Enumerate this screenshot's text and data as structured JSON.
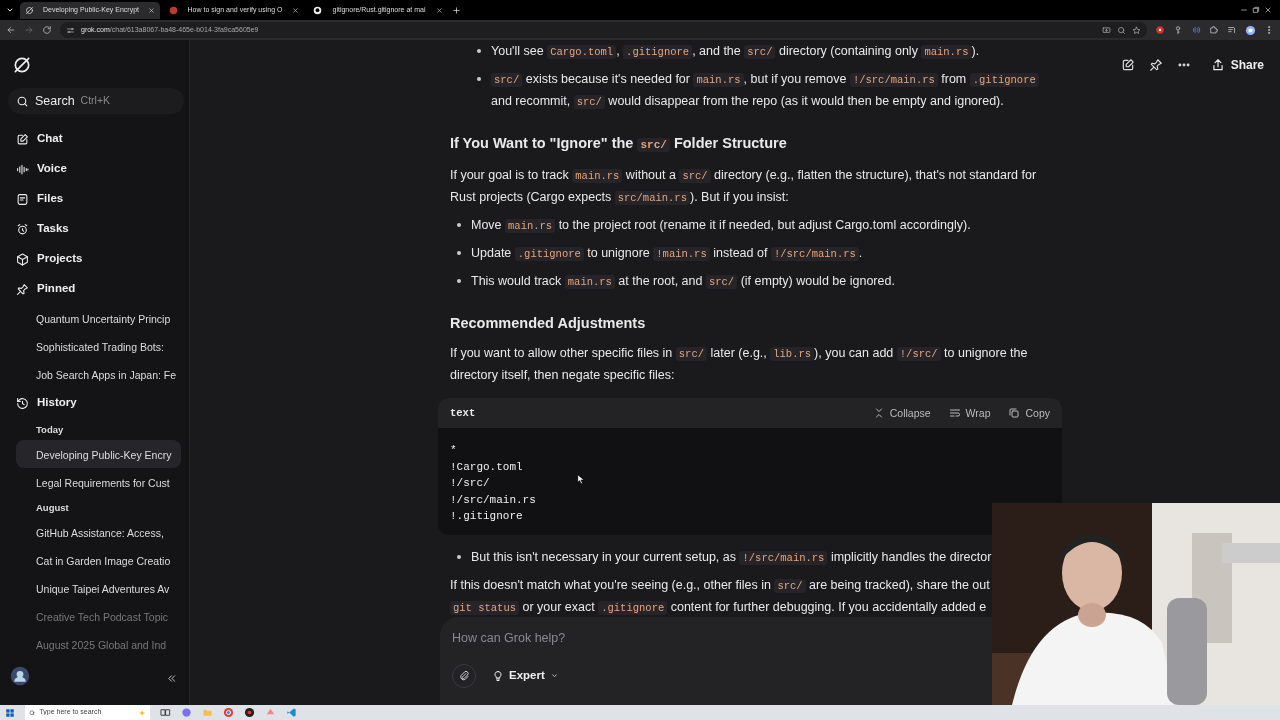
{
  "browser": {
    "tabs": [
      {
        "title": "Developing Public-Key Encrypt",
        "selected": true
      },
      {
        "title": "How to sign and verify using O",
        "selected": false
      },
      {
        "title": "gitignore/Rust.gitignore at mai",
        "selected": false
      }
    ],
    "address": {
      "host": "grok.com",
      "path": "/chat/613a8067-ba48-465e-b014-3fa9ca5605e9"
    }
  },
  "sidebar": {
    "search": {
      "label": "Search",
      "shortcut": "Ctrl+K"
    },
    "items": [
      {
        "label": "Chat"
      },
      {
        "label": "Voice"
      },
      {
        "label": "Files"
      },
      {
        "label": "Tasks"
      },
      {
        "label": "Projects"
      },
      {
        "label": "Pinned",
        "children": [
          {
            "label": "Quantum Uncertainty Princip",
            "selected": false,
            "dim": false
          },
          {
            "label": "Sophisticated Trading Bots:",
            "selected": false,
            "dim": false
          },
          {
            "label": "Job Search Apps in Japan: Fe",
            "selected": false,
            "dim": false
          }
        ]
      },
      {
        "label": "History",
        "groups": [
          {
            "label": "Today",
            "children": [
              {
                "label": "Developing Public-Key Encry",
                "selected": true,
                "dim": false
              },
              {
                "label": "Legal Requirements for Cust",
                "selected": false,
                "dim": false
              }
            ]
          },
          {
            "label": "August",
            "children": [
              {
                "label": "GitHub Assistance: Access,",
                "selected": false,
                "dim": false
              },
              {
                "label": "Cat in Garden Image Creatio",
                "selected": false,
                "dim": false
              },
              {
                "label": "Unique Taipei Adventures Av",
                "selected": false,
                "dim": false
              },
              {
                "label": "Creative Tech Podcast Topic",
                "selected": false,
                "dim": true
              },
              {
                "label": "August 2025 Global and Ind",
                "selected": false,
                "dim": true
              }
            ]
          }
        ]
      }
    ]
  },
  "header": {
    "share": "Share"
  },
  "message": [
    {
      "kind": "subbullet",
      "parts": [
        "You'll see ",
        {
          "code": "Cargo.toml"
        },
        ", ",
        {
          "code": ".gitignore"
        },
        ", and the ",
        {
          "code": "src/"
        },
        " directory (containing only ",
        {
          "code": "main.rs"
        },
        ")."
      ]
    },
    {
      "kind": "subbullet",
      "parts": [
        {
          "code": "src/"
        },
        " exists because it's needed for ",
        {
          "code": "main.rs"
        },
        ", but if you remove ",
        {
          "code": "!/src/main.rs"
        },
        " from ",
        {
          "code": ".gitignore"
        },
        " and recommit, ",
        {
          "code": "src/"
        },
        " would disappear from the repo (as it would then be empty and ignored)."
      ]
    },
    {
      "kind": "heading",
      "parts": [
        "If You Want to \"Ignore\" the ",
        {
          "code": "src/"
        },
        " Folder Structure"
      ]
    },
    {
      "kind": "paragraph",
      "parts": [
        "If your goal is to track ",
        {
          "code": "main.rs"
        },
        " without a ",
        {
          "code": "src/"
        },
        " directory (e.g., flatten the structure), that's not standard for Rust projects (Cargo expects ",
        {
          "code": "src/main.rs"
        },
        "). But if you insist:"
      ]
    },
    {
      "kind": "bullet",
      "parts": [
        "Move ",
        {
          "code": "main.rs"
        },
        " to the project root (rename it if needed, but adjust Cargo.toml accordingly)."
      ]
    },
    {
      "kind": "bullet",
      "parts": [
        "Update ",
        {
          "code": ".gitignore"
        },
        " to unignore ",
        {
          "code": "!main.rs"
        },
        " instead of ",
        {
          "code": "!/src/main.rs"
        },
        "."
      ]
    },
    {
      "kind": "bullet",
      "parts": [
        "This would track ",
        {
          "code": "main.rs"
        },
        " at the root, and ",
        {
          "code": "src/"
        },
        " (if empty) would be ignored."
      ]
    },
    {
      "kind": "heading",
      "parts": [
        "Recommended Adjustments"
      ]
    },
    {
      "kind": "paragraph",
      "parts": [
        "If you want to allow other specific files in ",
        {
          "code": "src/"
        },
        " later (e.g., ",
        {
          "code": "lib.rs"
        },
        "), you can add ",
        {
          "code": "!/src/"
        },
        " to unignore the directory itself, then negate specific files:"
      ]
    },
    {
      "kind": "codeblock",
      "language": "text",
      "actions": [
        {
          "label": "Collapse"
        },
        {
          "label": "Wrap"
        },
        {
          "label": "Copy"
        }
      ],
      "lines": [
        "*",
        "!Cargo.toml",
        "!/src/",
        "!/src/main.rs",
        "!.gitignore"
      ]
    },
    {
      "kind": "cutbullet",
      "parts": [
        "But this isn't necessary in your current setup, as ",
        {
          "code": "!/src/main.rs"
        },
        " implicitly handles the director"
      ]
    },
    {
      "kind": "cutline",
      "parts": [
        "If this doesn't match what you're seeing (e.g., other files in ",
        {
          "code": "src/"
        },
        " are being tracked), share the out"
      ]
    },
    {
      "kind": "cutline",
      "parts": [
        {
          "code": "git status"
        },
        " or your exact ",
        {
          "code": ".gitignore"
        },
        " content for further debugging. If you accidentally added e"
      ]
    }
  ],
  "composer": {
    "placeholder": "How can Grok help?",
    "mode": "Expert"
  },
  "taskbar": {
    "search_placeholder": "Type here to search"
  }
}
